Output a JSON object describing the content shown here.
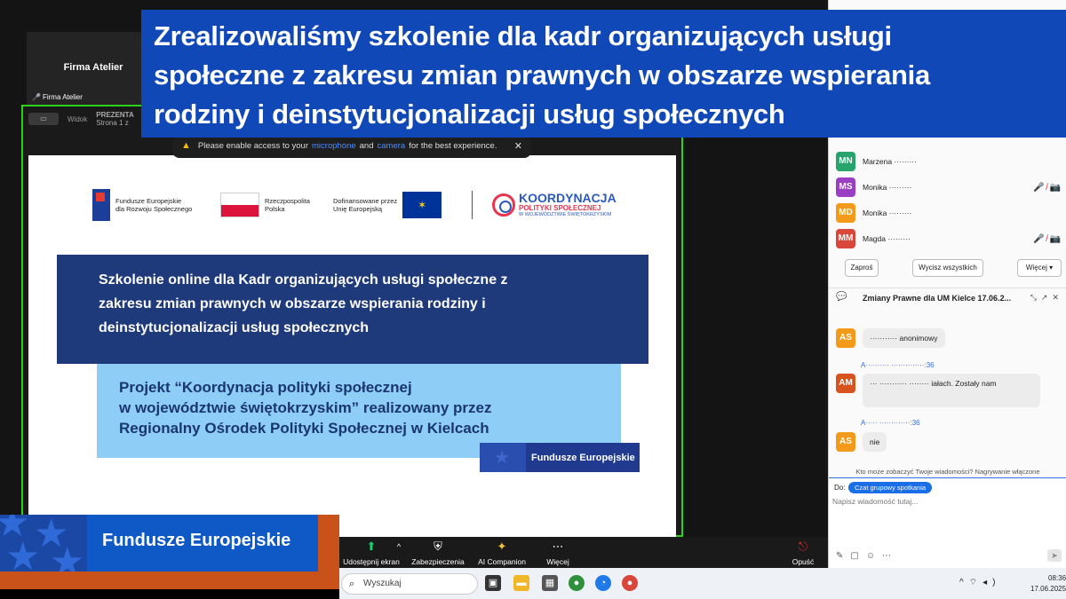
{
  "banner": {
    "lines": [
      "Zrealizowaliśmy szkolenie dla kadr organizujących usługi",
      "społeczne z zakresu zmian prawnych w obszarze wspierania",
      "rodziny i deinstytucjonalizacji usług społecznych"
    ]
  },
  "tile": {
    "name": "Firma Atelier",
    "footer": "Firma Atelier"
  },
  "share_toolbar": {
    "view_label_1": "Widok",
    "view_label_2": "Widok",
    "presenter_1": "PREZENTA",
    "presenter_2": "Strona 1 z"
  },
  "permission_bar": {
    "text_before": "Please enable access to your",
    "microphone": "microphone",
    "and": "and",
    "camera": "camera",
    "text_after": "for the best experience.",
    "close": "✕"
  },
  "slide": {
    "logo1": [
      "Fundusze Europejskie",
      "dla Rozwoju Społecznego"
    ],
    "logo2": [
      "Rzeczpospolita",
      "Polska"
    ],
    "logo3": [
      "Dofinansowane przez",
      "Unię Europejską"
    ],
    "logo4": {
      "k1": "KOORDYNACJA",
      "k2": "POLITYKI SPOŁECZNEJ",
      "k3": "W WOJEWÓDZTWIE ŚWIĘTOKRZYSKIM"
    },
    "dark_lines": [
      "Szkolenie online dla Kadr organizujących usługi społeczne z",
      "zakresu zmian prawnych w obszarze wspierania rodziny i",
      "deinstytucjonalizacji usług społecznych"
    ],
    "light_lines": [
      "Projekt “Koordynacja polityki społecznej",
      "w województwie świętokrzyskim” realizowany przez",
      "Regionalny Ośrodek Polityki Społecznej w Kielcach"
    ],
    "fe_small": "Fundusze Europejskie"
  },
  "zoom_bar": {
    "share": "Udostępnij ekran",
    "security": "Zabezpieczenia",
    "ai": "AI Companion",
    "more": "Więcej",
    "leave": "Opuść"
  },
  "participants": [
    {
      "initials": "MN",
      "color": "#27a46b",
      "name": "Marzena ·········"
    },
    {
      "initials": "MS",
      "color": "#9a3fc3",
      "name": "Monika ·········"
    },
    {
      "initials": "MD",
      "color": "#f39a1a",
      "name": "Monika ·········"
    },
    {
      "initials": "MM",
      "color": "#d9463a",
      "name": "Magda ·········"
    }
  ],
  "participant_buttons": {
    "invite": "Zaproś",
    "mute_all": "Wycisz wszystkich",
    "more": "Więcej ▾"
  },
  "chat": {
    "title": "Zmiany Prawne dla UM Kielce 17.06.2...",
    "messages": [
      {
        "initials": "AS",
        "color": "#f39a1a",
        "text": "··········· anonimowy"
      },
      {
        "initials": "AM",
        "color": "#d9531e",
        "text": "··· ··········· ········ iałach. Zostały nam"
      },
      {
        "initials": "AS",
        "color": "#f39a1a",
        "text": "nie"
      }
    ],
    "meta1": "A·········· ··············:36",
    "meta2": "A····· ·············:36",
    "note": "Kto może zobaczyć Twoje wiadomości? Nagrywanie włączone",
    "to_label": "Do:",
    "to_pill": "Czat grupowy spotkania",
    "placeholder": "Napisz wiadomość tutaj..."
  },
  "taskbar": {
    "search": "Wyszukaj",
    "time": "08:36",
    "date": "17.06.2025"
  },
  "fe_badge": {
    "label": "Fundusze Europejskie"
  }
}
